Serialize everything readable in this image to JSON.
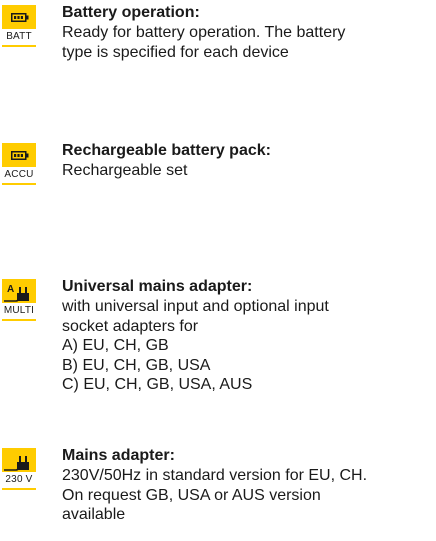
{
  "colors": {
    "accent": "#ffcc00",
    "text": "#1a1a1a"
  },
  "entries": [
    {
      "icon_name": "battery-icon",
      "code": "BATT",
      "title": "Battery operation:",
      "lines": [
        "Ready for battery operation. The battery",
        "type is specified for each device"
      ]
    },
    {
      "icon_name": "battery-icon",
      "code": "ACCU",
      "title": "Rechargeable battery pack:",
      "lines": [
        "Rechargeable set"
      ]
    },
    {
      "icon_name": "plug-icon",
      "icon_letter": "A",
      "code": "MULTI",
      "title": "Universal mains adapter:",
      "lines": [
        "with universal input and optional input",
        "socket adapters for",
        "A) EU, CH, GB",
        "B) EU, CH, GB, USA",
        "C) EU, CH, GB, USA, AUS"
      ]
    },
    {
      "icon_name": "plug-icon",
      "code": "230 V",
      "title": "Mains adapter:",
      "lines": [
        "230V/50Hz in standard version for EU, CH.",
        "On request GB, USA or AUS version",
        "available"
      ]
    }
  ]
}
